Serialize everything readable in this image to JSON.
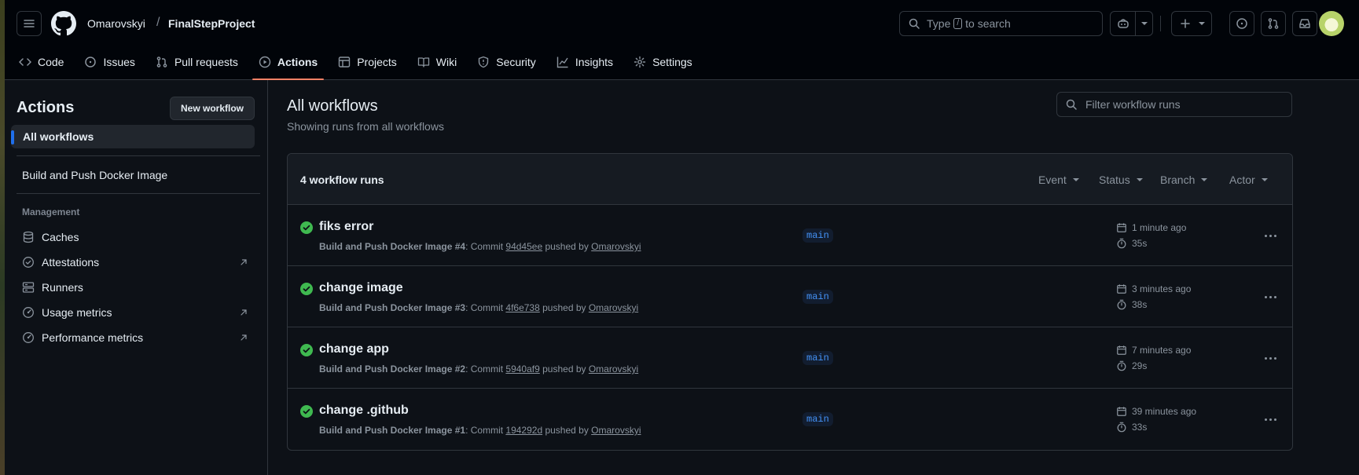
{
  "header": {
    "owner": "Omarovskyi",
    "separator": "/",
    "repo": "FinalStepProject",
    "search_prefix": "Type",
    "search_key": "/",
    "search_suffix": "to search"
  },
  "tabs": [
    {
      "label": "Code",
      "icon": "code-icon"
    },
    {
      "label": "Issues",
      "icon": "issue-opened-icon"
    },
    {
      "label": "Pull requests",
      "icon": "git-pull-request-icon"
    },
    {
      "label": "Actions",
      "icon": "play-icon",
      "active": true
    },
    {
      "label": "Projects",
      "icon": "table-icon"
    },
    {
      "label": "Wiki",
      "icon": "book-icon"
    },
    {
      "label": "Security",
      "icon": "shield-icon"
    },
    {
      "label": "Insights",
      "icon": "graph-icon"
    },
    {
      "label": "Settings",
      "icon": "gear-icon"
    }
  ],
  "sidebar": {
    "title": "Actions",
    "new_workflow": "New workflow",
    "all_workflows": "All workflows",
    "workflow": "Build and Push Docker Image",
    "group": "Management",
    "items": [
      {
        "label": "Caches",
        "icon": "database-icon",
        "external": false
      },
      {
        "label": "Attestations",
        "icon": "verified-icon",
        "external": true
      },
      {
        "label": "Runners",
        "icon": "server-icon",
        "external": false
      },
      {
        "label": "Usage metrics",
        "icon": "meter-icon",
        "external": true
      },
      {
        "label": "Performance metrics",
        "icon": "meter-icon",
        "external": true
      }
    ]
  },
  "main": {
    "title": "All workflows",
    "subtitle": "Showing runs from all workflows",
    "filter_placeholder": "Filter workflow runs",
    "count": "4 workflow runs",
    "filters": [
      "Event",
      "Status",
      "Branch",
      "Actor"
    ],
    "runs": [
      {
        "title": "fiks error",
        "workflow": "Build and Push Docker Image #4",
        "commit_label": ": Commit ",
        "sha": "94d45ee",
        "pushed": " pushed by ",
        "user": "Omarovskyi",
        "branch": "main",
        "when": "1 minute ago",
        "duration": "35s"
      },
      {
        "title": "change image",
        "workflow": "Build and Push Docker Image #3",
        "commit_label": ": Commit ",
        "sha": "4f6e738",
        "pushed": " pushed by ",
        "user": "Omarovskyi",
        "branch": "main",
        "when": "3 minutes ago",
        "duration": "38s"
      },
      {
        "title": "change app",
        "workflow": "Build and Push Docker Image #2",
        "commit_label": ": Commit ",
        "sha": "5940af9",
        "pushed": " pushed by ",
        "user": "Omarovskyi",
        "branch": "main",
        "when": "7 minutes ago",
        "duration": "29s"
      },
      {
        "title": "change .github",
        "workflow": "Build and Push Docker Image #1",
        "commit_label": ": Commit ",
        "sha": "194292d",
        "pushed": " pushed by ",
        "user": "Omarovskyi",
        "branch": "main",
        "when": "39 minutes ago",
        "duration": "33s"
      }
    ]
  },
  "colors": {
    "success": "#3fb950",
    "accent": "#1f6feb",
    "tab_underline": "#f78166"
  }
}
